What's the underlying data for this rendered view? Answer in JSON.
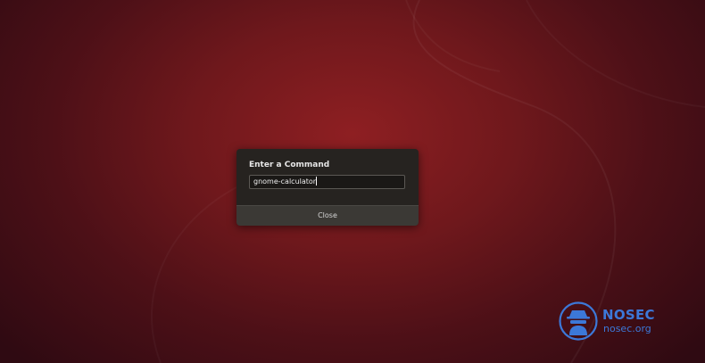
{
  "dialog": {
    "title": "Enter a Command",
    "input_value": "gnome-calculator",
    "close_label": "Close"
  },
  "watermark": {
    "name": "NOSEC",
    "url": "nosec.org"
  },
  "colors": {
    "wallpaper": "#7a1a1e",
    "dialog_bg": "#262320",
    "watermark": "#3c78d8"
  }
}
